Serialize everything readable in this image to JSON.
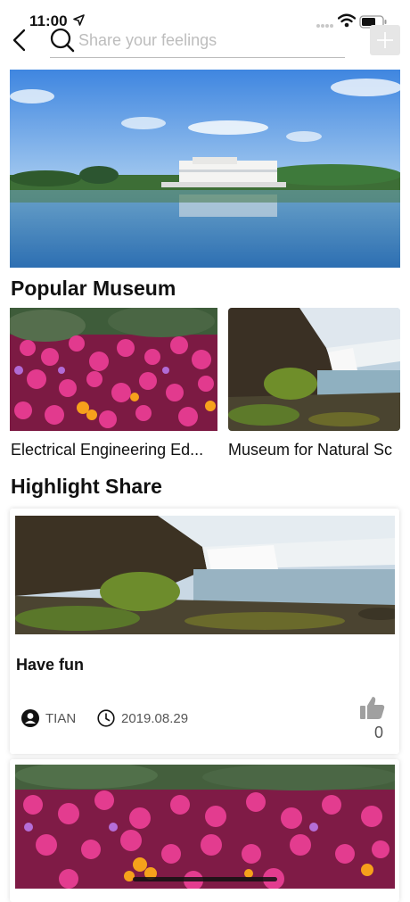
{
  "status_bar": {
    "time": "11:00"
  },
  "search": {
    "placeholder": "Share your feelings",
    "value": ""
  },
  "popular": {
    "title": "Popular Museum",
    "items": [
      {
        "label": "Electrical Engineering Ed..."
      },
      {
        "label": "Museum for Natural Sc"
      }
    ]
  },
  "highlight": {
    "title": "Highlight Share",
    "posts": [
      {
        "title": "Have fun",
        "author": "TIAN",
        "date": "2019.08.29",
        "likes": "0"
      }
    ]
  },
  "icons": [
    "back-icon",
    "search-icon",
    "add-icon",
    "user-icon",
    "clock-icon",
    "thumbs-up-icon"
  ]
}
